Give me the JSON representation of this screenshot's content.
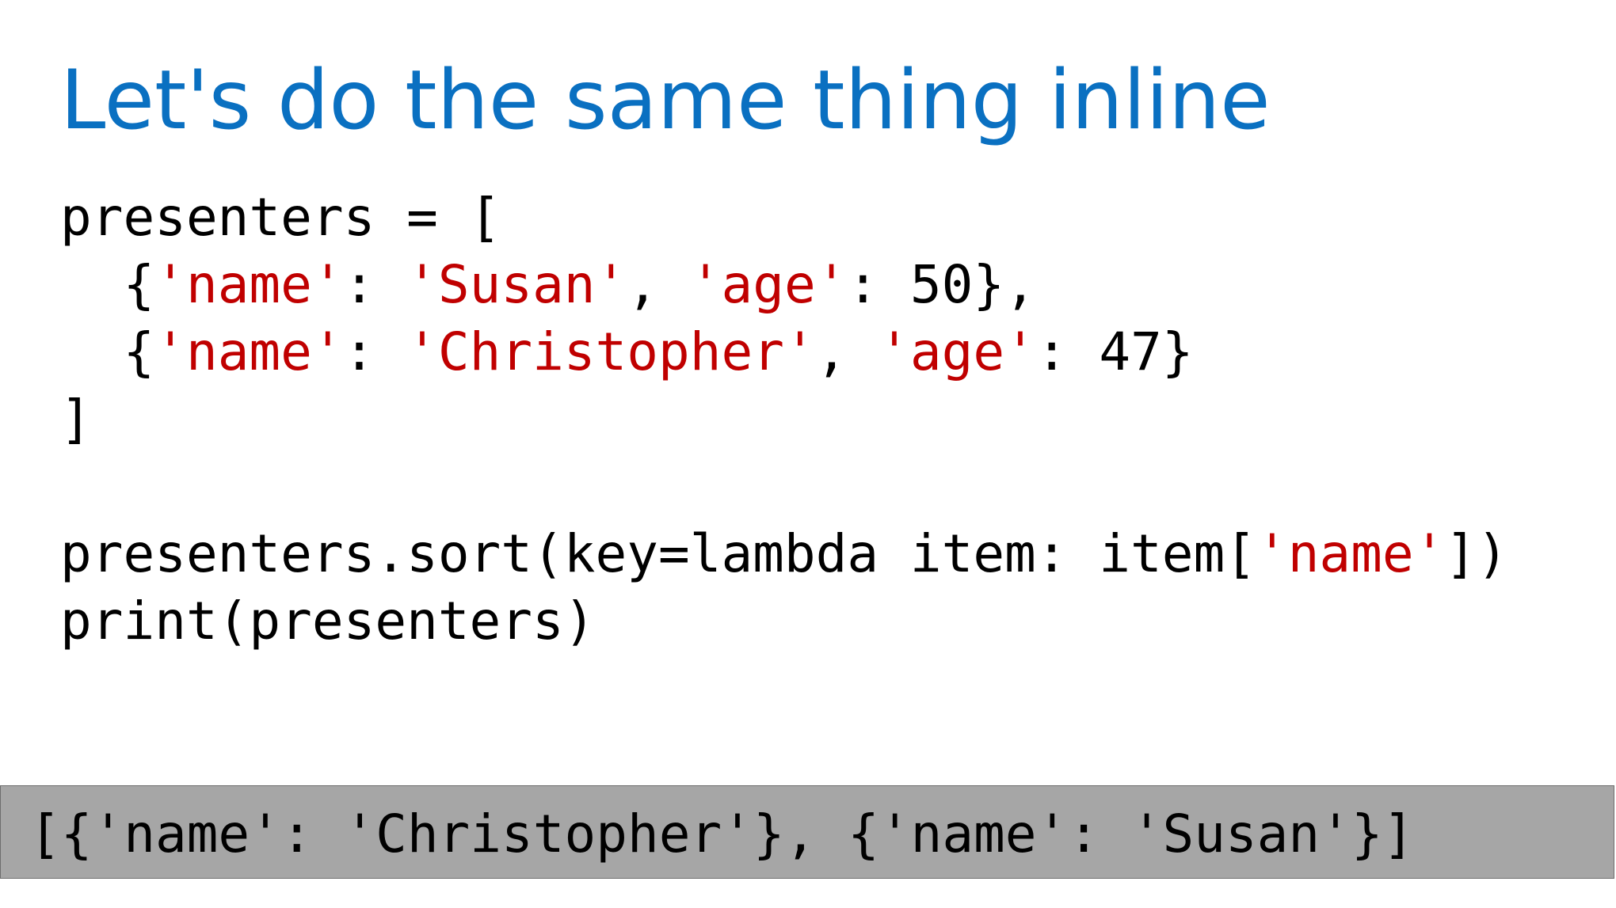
{
  "slide": {
    "title": "Let's do the same thing inline"
  },
  "code": {
    "line1": {
      "text": "presenters = ["
    },
    "line2": {
      "indent": "  {",
      "key1": "'name'",
      "sep1": ": ",
      "val1": "'Susan'",
      "comma": ", ",
      "key2": "'age'",
      "rest": ": 50},"
    },
    "line3": {
      "indent": "  {",
      "key1": "'name'",
      "sep1": ": ",
      "val1": "'Christopher'",
      "comma": ", ",
      "key2": "'age'",
      "rest": ": 47}"
    },
    "line4": {
      "text": "]"
    },
    "line6": {
      "pre": "presenters.sort(key=lambda item: item[",
      "str": "'name'",
      "post": "])"
    },
    "line7": {
      "text": "print(presenters)"
    }
  },
  "output": {
    "text": "[{'name': 'Christopher'}, {'name': 'Susan'}]"
  },
  "colors": {
    "title": "#0a70c1",
    "string_literal": "#c00000",
    "output_background": "#a6a6a6"
  }
}
